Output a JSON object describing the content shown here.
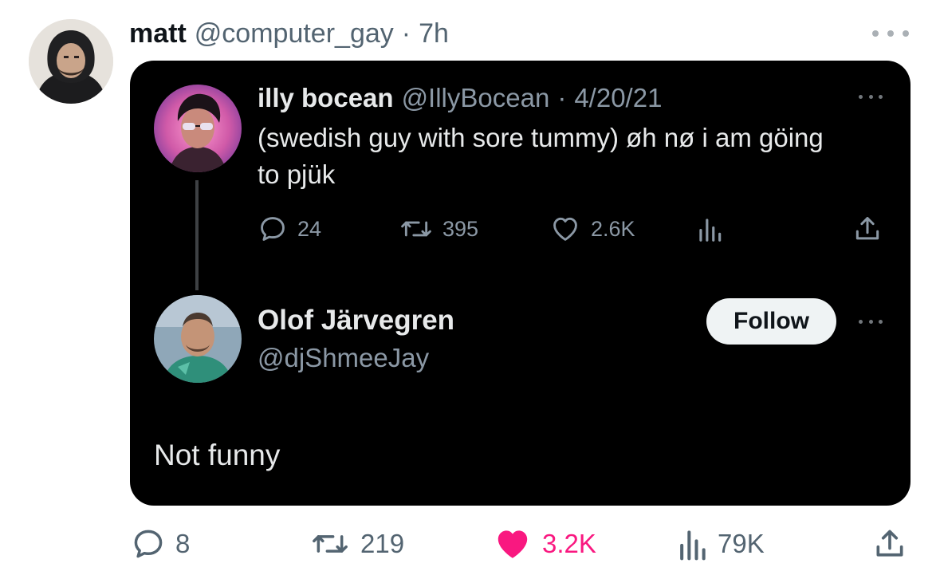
{
  "tweet": {
    "author_name": "matt",
    "author_handle": "@computer_gay",
    "separator": "·",
    "time": "7h",
    "avatar_icon": "person-avatar",
    "more_icon": "more-horizontal-icon"
  },
  "embedded": {
    "original": {
      "name": "illy bocean",
      "handle": "@IllyBocean",
      "separator": "·",
      "date": "4/20/21",
      "text": "(swedish guy with sore tummy) øh nø i am göing to pjük",
      "metrics": {
        "replies": "24",
        "retweets": "395",
        "likes": "2.6K"
      }
    },
    "reply": {
      "name": "Olof Järvegren",
      "handle": "@djShmeeJay",
      "follow_label": "Follow",
      "text": "Not funny"
    }
  },
  "actions": {
    "replies": "8",
    "retweets": "219",
    "likes": "3.2K",
    "views": "79K",
    "liked": true,
    "like_color": "#f91880"
  }
}
